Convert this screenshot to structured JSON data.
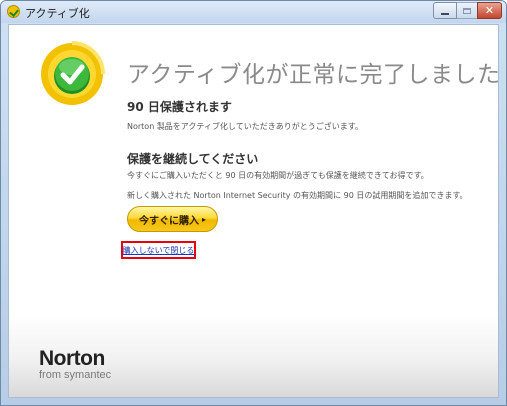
{
  "window": {
    "title": "アクティブ化",
    "close_glyph": "✕"
  },
  "main": {
    "headline": "アクティブ化が正常に完了しました",
    "section1": {
      "heading": "90 日保護されます",
      "text": "Norton 製品をアクティブ化していただきありがとうございます。"
    },
    "section2": {
      "heading": "保護を継続してください",
      "text1": "今すぐにご購入いただくと 90 日の有効期間が過ぎても保護を継続できてお得です。",
      "text2": "新しく購入された Norton Internet Security の有効期間に 90 日の試用期間を追加できます。"
    },
    "buy_button": {
      "label": "今すぐに購入",
      "arrow": "▸"
    },
    "close_link": "購入しないで閉じる"
  },
  "brand": {
    "name": "Norton",
    "sub": "from symantec"
  },
  "icons": {
    "app": "norton-check-icon",
    "logo": "norton-check-logo"
  },
  "colors": {
    "accent_yellow": "#f4c300",
    "check_green": "#2ea62e",
    "highlight_red": "#e4000f",
    "link_blue": "#1a39b8"
  }
}
